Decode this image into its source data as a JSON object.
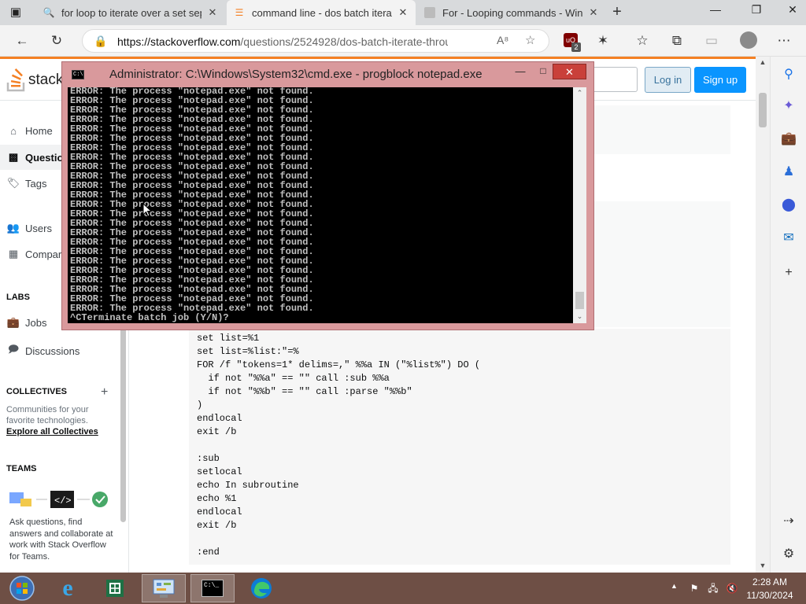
{
  "browser": {
    "tabs": [
      {
        "title": "for loop to iterate over a set sep",
        "favicon": "search-icon"
      },
      {
        "title": "command line - dos batch iterat",
        "favicon": "stackoverflow-icon"
      },
      {
        "title": "For - Looping commands - Wind",
        "favicon": "page-icon"
      }
    ],
    "url_host": "https://stackoverflow.com",
    "url_path": "/questions/2524928/dos-batch-iterate-through-...",
    "ublock_count": "2"
  },
  "so": {
    "logo_text": "stack",
    "login_label": "Log in",
    "signup_label": "Sign up",
    "nav": {
      "home": "Home",
      "questions": "Questio",
      "tags": "Tags",
      "users": "Users",
      "companies": "Compar",
      "labs_header": "LABS",
      "jobs": "Jobs",
      "discussions": "Discussions",
      "collectives_header": "COLLECTIVES",
      "collectives_desc": "Communities for your favorite technologies.",
      "explore_link": "Explore all Collectives",
      "teams_header": "TEAMS",
      "teams_desc": "Ask questions, find answers and collaborate at work with Stack Overflow for Teams."
    },
    "code_block": "set list=%1\nset list=%list:\"=%\nFOR /f \"tokens=1* delims=,\" %%a IN (\"%list%\") DO (\n  if not \"%%a\" == \"\" call :sub %%a\n  if not \"%%b\" == \"\" call :parse \"%%b\"\n)\nendlocal\nexit /b\n\n:sub\nsetlocal\necho In subroutine\necho %1\nendlocal\nexit /b\n\n:end"
  },
  "cmd": {
    "title": "Administrator: C:\\Windows\\System32\\cmd.exe - progblock  notepad.exe",
    "error_line": "ERROR: The process \"notepad.exe\" not found.",
    "error_count": 24,
    "last_line": "^CTerminate batch job (Y/N)?"
  },
  "taskbar": {
    "time": "2:28 AM",
    "date": "11/30/2024"
  },
  "colors": {
    "so_orange": "#f48024",
    "so_blue": "#0a95ff",
    "cmd_frame": "#d9999c",
    "taskbar": "#6e4f45"
  }
}
